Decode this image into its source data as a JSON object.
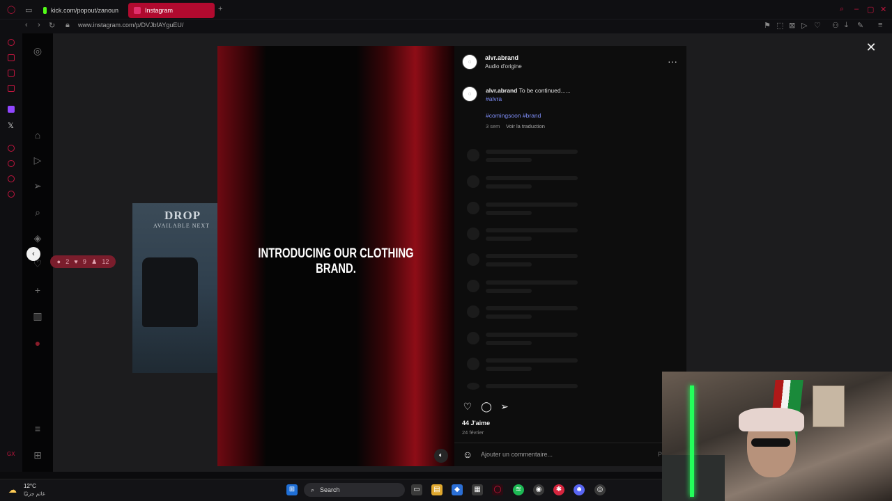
{
  "browser": {
    "tabs": [
      {
        "label": "kick.com/popout/zanoun",
        "active": false
      },
      {
        "label": "Instagram",
        "active": true
      }
    ],
    "url": "www.instagram.com/p/DVJbfAYguEU/"
  },
  "feed_preview": {
    "title": "DROP",
    "subtitle": "AVAILABLE NEXT",
    "stats": {
      "comments": "2",
      "likes": "9",
      "views": "12"
    }
  },
  "reel": {
    "overlay_text": "Introducing our clothing brand."
  },
  "post": {
    "author": "alvr.abrand",
    "audio": "Audio d'origine",
    "caption_user": "alvr.abrand",
    "caption_text": "To be continued......",
    "caption_tag": "#alvra",
    "hashtags": "#comingsoon #brand",
    "age": "3 sem",
    "translate": "Voir la traduction",
    "likes": "44 J'aime",
    "date": "24 février",
    "comment_placeholder": "Ajouter un commentaire...",
    "publish_label": "P"
  },
  "taskbar": {
    "weather_temp": "12°C",
    "weather_desc": "غائم جزئيًا",
    "search_label": "Search"
  },
  "colors": {
    "accent": "#b10a2f",
    "link": "#7d8cf5",
    "panel": "#0d0d0d"
  }
}
